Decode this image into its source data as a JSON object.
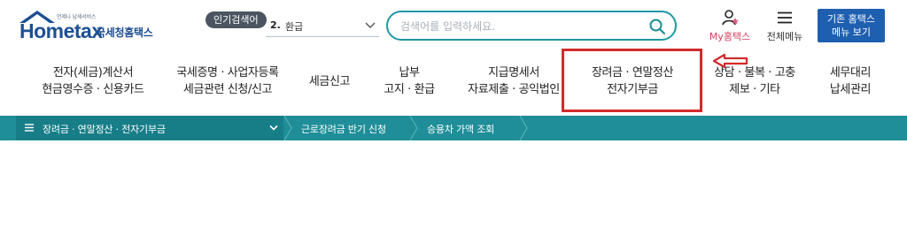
{
  "header": {
    "logo": {
      "tagline": "언제나 납세서비스",
      "wordmark": "Hometax",
      "korean_name": "국세청홈택스"
    },
    "popular": {
      "badge": "인기검색어",
      "rank": "2.",
      "term": "환급"
    },
    "search": {
      "placeholder": "검색어를 입력하세요."
    },
    "my_hometax": "My홈택스",
    "all_menu": "전체메뉴",
    "classic_button": [
      "기존 홈택스",
      "메뉴 보기"
    ]
  },
  "nav": {
    "items": [
      {
        "lines": [
          "전자(세금)계산서",
          "현금영수증 · 신용카드"
        ]
      },
      {
        "lines": [
          "국세증명 · 사업자등록",
          "세금관련 신청/신고"
        ]
      },
      {
        "lines": [
          "세금신고"
        ]
      },
      {
        "lines": [
          "납부",
          "고지 · 환급"
        ]
      },
      {
        "lines": [
          "지급명세서",
          "자료제출 · 공익법인"
        ]
      },
      {
        "lines": [
          "장려금 · 연말정산",
          "전자기부금"
        ]
      },
      {
        "lines": [
          "상담 · 불복 · 고충",
          "제보 · 기타"
        ]
      },
      {
        "lines": [
          "세무대리",
          "납세관리"
        ]
      }
    ],
    "highlighted_index": 5
  },
  "breadcrumb": {
    "menu": "장려금 · 연말정산 · 전자기부금",
    "crumbs": [
      "근로장려금 반기 신청",
      "승용차 가액 조회"
    ]
  },
  "colors": {
    "brand_blue": "#1d4f93",
    "teal_bar": "#1f8e98",
    "teal_bar_dark": "#177e88",
    "highlight_red": "#d12b2b",
    "classic_button": "#1f5fb0"
  }
}
